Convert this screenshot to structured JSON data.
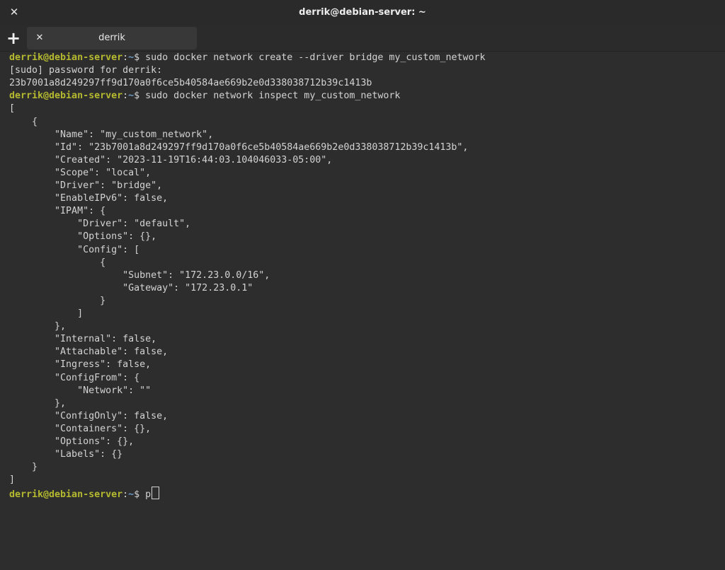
{
  "window": {
    "title": "derrik@debian-server: ~",
    "close_icon": "close-icon"
  },
  "tabs": {
    "new_tab_icon": "plus-icon",
    "items": [
      {
        "label": "derrik",
        "close_icon": "close-icon"
      }
    ]
  },
  "colors": {
    "background": "#2d2d2d",
    "text": "#d3d3d3",
    "prompt_user": "#b5b92f",
    "prompt_path": "#6c9bc7"
  },
  "terminal": {
    "prompt": {
      "user_host": "derrik@debian-server",
      "path": "~",
      "sep": ":",
      "sigil": "$ "
    },
    "lines": [
      {
        "kind": "prompt",
        "cmd": "sudo docker network create --driver bridge my_custom_network"
      },
      {
        "kind": "output",
        "text": "[sudo] password for derrik:"
      },
      {
        "kind": "output",
        "text": "23b7001a8d249297ff9d170a0f6ce5b40584ae669b2e0d338038712b39c1413b"
      },
      {
        "kind": "prompt",
        "cmd": "sudo docker network inspect my_custom_network"
      },
      {
        "kind": "output",
        "text": "["
      },
      {
        "kind": "output",
        "text": "    {"
      },
      {
        "kind": "output",
        "text": "        \"Name\": \"my_custom_network\","
      },
      {
        "kind": "output",
        "text": "        \"Id\": \"23b7001a8d249297ff9d170a0f6ce5b40584ae669b2e0d338038712b39c1413b\","
      },
      {
        "kind": "output",
        "text": "        \"Created\": \"2023-11-19T16:44:03.104046033-05:00\","
      },
      {
        "kind": "output",
        "text": "        \"Scope\": \"local\","
      },
      {
        "kind": "output",
        "text": "        \"Driver\": \"bridge\","
      },
      {
        "kind": "output",
        "text": "        \"EnableIPv6\": false,"
      },
      {
        "kind": "output",
        "text": "        \"IPAM\": {"
      },
      {
        "kind": "output",
        "text": "            \"Driver\": \"default\","
      },
      {
        "kind": "output",
        "text": "            \"Options\": {},"
      },
      {
        "kind": "output",
        "text": "            \"Config\": ["
      },
      {
        "kind": "output",
        "text": "                {"
      },
      {
        "kind": "output",
        "text": "                    \"Subnet\": \"172.23.0.0/16\","
      },
      {
        "kind": "output",
        "text": "                    \"Gateway\": \"172.23.0.1\""
      },
      {
        "kind": "output",
        "text": "                }"
      },
      {
        "kind": "output",
        "text": "            ]"
      },
      {
        "kind": "output",
        "text": "        },"
      },
      {
        "kind": "output",
        "text": "        \"Internal\": false,"
      },
      {
        "kind": "output",
        "text": "        \"Attachable\": false,"
      },
      {
        "kind": "output",
        "text": "        \"Ingress\": false,"
      },
      {
        "kind": "output",
        "text": "        \"ConfigFrom\": {"
      },
      {
        "kind": "output",
        "text": "            \"Network\": \"\""
      },
      {
        "kind": "output",
        "text": "        },"
      },
      {
        "kind": "output",
        "text": "        \"ConfigOnly\": false,"
      },
      {
        "kind": "output",
        "text": "        \"Containers\": {},"
      },
      {
        "kind": "output",
        "text": "        \"Options\": {},"
      },
      {
        "kind": "output",
        "text": "        \"Labels\": {}"
      },
      {
        "kind": "output",
        "text": "    }"
      },
      {
        "kind": "output",
        "text": "]"
      },
      {
        "kind": "prompt",
        "cmd": "p",
        "cursor": true
      }
    ]
  }
}
